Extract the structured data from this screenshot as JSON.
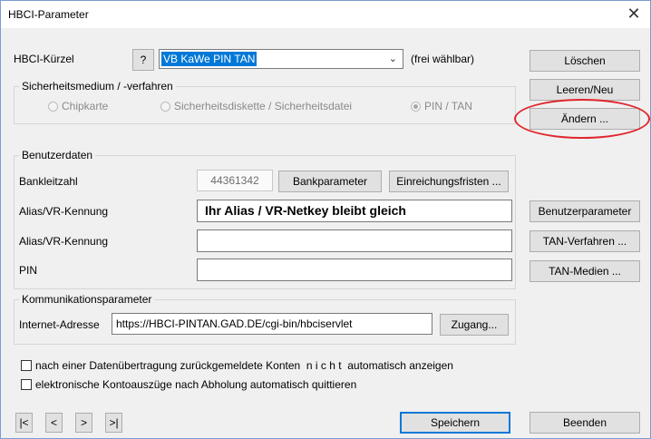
{
  "window": {
    "title": "HBCI-Parameter",
    "close_glyph": "✕"
  },
  "kuerzel": {
    "label": "HBCI-Kürzel",
    "help": "?",
    "value": "VB KaWe PIN TAN",
    "hint": "(frei wählbar)"
  },
  "sicherheit": {
    "group_label": "Sicherheitsmedium / -verfahren",
    "options": [
      "Chipkarte",
      "Sicherheitsdiskette / Sicherheitsdatei",
      "PIN / TAN"
    ],
    "selected": "PIN / TAN"
  },
  "benutzerdaten": {
    "group_label": "Benutzerdaten",
    "blz_label": "Bankleitzahl",
    "blz_value": "44361342",
    "bankparameter_btn": "Bankparameter",
    "fristen_btn": "Einreichungsfristen ...",
    "alias1_label": "Alias/VR-Kennung",
    "alias1_value": "Ihr Alias / VR-Netkey bleibt gleich",
    "alias2_label": "Alias/VR-Kennung",
    "alias2_value": "",
    "pin_label": "PIN",
    "pin_value": ""
  },
  "kommunikation": {
    "group_label": "Kommunikationsparameter",
    "address_label": "Internet-Adresse",
    "address_value": "https://HBCI-PINTAN.GAD.DE/cgi-bin/hbciservlet",
    "zugang_btn": "Zugang..."
  },
  "checkboxes": [
    {
      "label": "nach einer Datenübertragung zurückgemeldete Konten  n i c h t  automatisch anzeigen",
      "checked": false
    },
    {
      "label": "elektronische Kontoauszüge nach Abholung automatisch quittieren",
      "checked": false
    }
  ],
  "right_buttons": {
    "loeschen": "Löschen",
    "leeren": "Leeren/Neu",
    "aendern": "Ändern ...",
    "benutzerparameter": "Benutzerparameter",
    "tan_verfahren": "TAN-Verfahren ...",
    "tan_medien": "TAN-Medien ..."
  },
  "nav": {
    "first": "|<",
    "prev": "<",
    "next": ">",
    "last": ">|"
  },
  "bottom": {
    "speichern": "Speichern",
    "beenden": "Beenden"
  },
  "colors": {
    "accent": "#0078d7",
    "annotation": "#e0262d"
  }
}
